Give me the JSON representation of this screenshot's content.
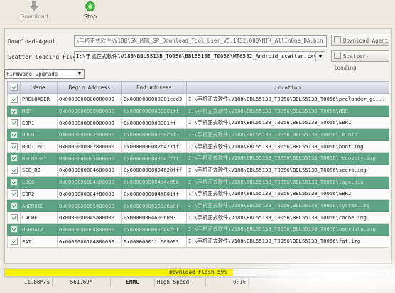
{
  "toolbar": {
    "download_label": "Download",
    "stop_label": "Stop",
    "download_icon": "download-arrow-icon",
    "stop_icon": "green-stop-icon"
  },
  "download_agent": {
    "label": "Download-Agent",
    "value": "\\手机正式软件\\V188\\GN_MTK_SP_Download_Tool_User_V5.1432.000\\MTK_AllInOne_DA.bin",
    "button": "Download Agent"
  },
  "scatter": {
    "label": "Scatter-loading File",
    "value": "I:\\手机正式软件\\V188\\BBL5513B_T0056\\BBL5513B_T0056\\MT6582_Android_scatter.txt",
    "button": "Scatter-loading"
  },
  "mode": {
    "selected": "Firmware Upgrade"
  },
  "table": {
    "headers": [
      "",
      "Name",
      "Begin Address",
      "End Address",
      "Location"
    ],
    "rows": [
      {
        "name": "PRELOADER",
        "begin": "0x0000000000000000",
        "end": "0x0000000000001ced3",
        "location": "I:\\手机正式软件\\V188\\BBL5513B_T0056\\BBL5513B_T0056\\preloader_gi...",
        "style": "white"
      },
      {
        "name": "MBR",
        "begin": "0x0000000000000000",
        "end": "0x00000000000001ff",
        "location": "I:\\手机正式软件\\V188\\BBL5513B_T0056\\BBL5513B_T0056\\MBR",
        "style": "green"
      },
      {
        "name": "EBR1",
        "begin": "0x0000000000000000",
        "end": "0x0000000000001ff",
        "location": "I:\\手机正式软件\\V188\\BBL5513B_T0056\\BBL5513B_T0056\\EBR1",
        "style": "white"
      },
      {
        "name": "UBOOT",
        "begin": "0x0000000002500000",
        "end": "0x000000000258c5f3",
        "location": "I:\\手机正式软件\\V188\\BBL5513B_T0056\\BBL5513B_T0056\\lk.bin",
        "style": "green"
      },
      {
        "name": "BOOTIMG",
        "begin": "0x0000000002800000",
        "end": "0x0000000002b427ff",
        "location": "I:\\手机正式软件\\V188\\BBL5513B_T0056\\BBL5513B_T0056\\boot.img",
        "style": "white"
      },
      {
        "name": "RECOVERY",
        "begin": "0x0000000003800000",
        "end": "0x0000000003b4ffff",
        "location": "I:\\手机正式软件\\V188\\BBL5513B_T0056\\BBL5513B_T0056\\recovery.img",
        "style": "green"
      },
      {
        "name": "SEC_RO",
        "begin": "0x0000000004600000",
        "end": "0x00000000004620fff",
        "location": "I:\\手机正式软件\\V188\\BBL5513B_T0056\\BBL5513B_T0056\\secro.img",
        "style": "white"
      },
      {
        "name": "LOGO",
        "begin": "0x0000000004c00000",
        "end": "0x0000000004d4c05b",
        "location": "I:\\手机正式软件\\V188\\BBL5513B_T0056\\BBL5513B_T0056\\logo.bin",
        "style": "green"
      },
      {
        "name": "EBR2",
        "begin": "0x0000000004f80000",
        "end": "0x0000000004f801ff",
        "location": "I:\\手机正式软件\\V188\\BBL5513B_T0056\\BBL5513B_T0056\\EBR2",
        "style": "white"
      },
      {
        "name": "ANDROID",
        "begin": "0x0000000005000000",
        "end": "0x00000000368a6a6f",
        "location": "I:\\手机正式软件\\V188\\BBL5513B_T0056\\BBL5513B_T0056\\system.img",
        "style": "green"
      },
      {
        "name": "CACHE",
        "begin": "0x0000000045a00000",
        "end": "0x000000046006093",
        "location": "I:\\手机正式软件\\V188\\BBL5513B_T0056\\BBL5513B_T0056\\cache.img",
        "style": "white"
      },
      {
        "name": "USRDATA",
        "begin": "0x0000000064800000",
        "end": "0x0000000065b46f9f",
        "location": "I:\\手机正式软件\\V188\\BBL5513B_T0056\\BBL5513B_T0056\\userdata.img",
        "style": "green"
      },
      {
        "name": "FAT",
        "begin": "0x0000000104800000",
        "end": "0x000000011c669093",
        "location": "I:\\手机正式软件\\V188\\BBL5513B_T0056\\BBL5513B_T0056\\fat.img",
        "style": "white"
      }
    ]
  },
  "progress": {
    "label": "Download Flash 59%",
    "fraction": 0.59,
    "color": "#f5f000"
  },
  "status": {
    "speed": "11.88M/s",
    "size": "561.69M",
    "storage": "EMMC",
    "usb_speed": "High Speed",
    "time": "0:16"
  },
  "colors": {
    "green_row": "#5fa585",
    "white_row": "#fbfbfb",
    "header": "#c9ccd8"
  }
}
